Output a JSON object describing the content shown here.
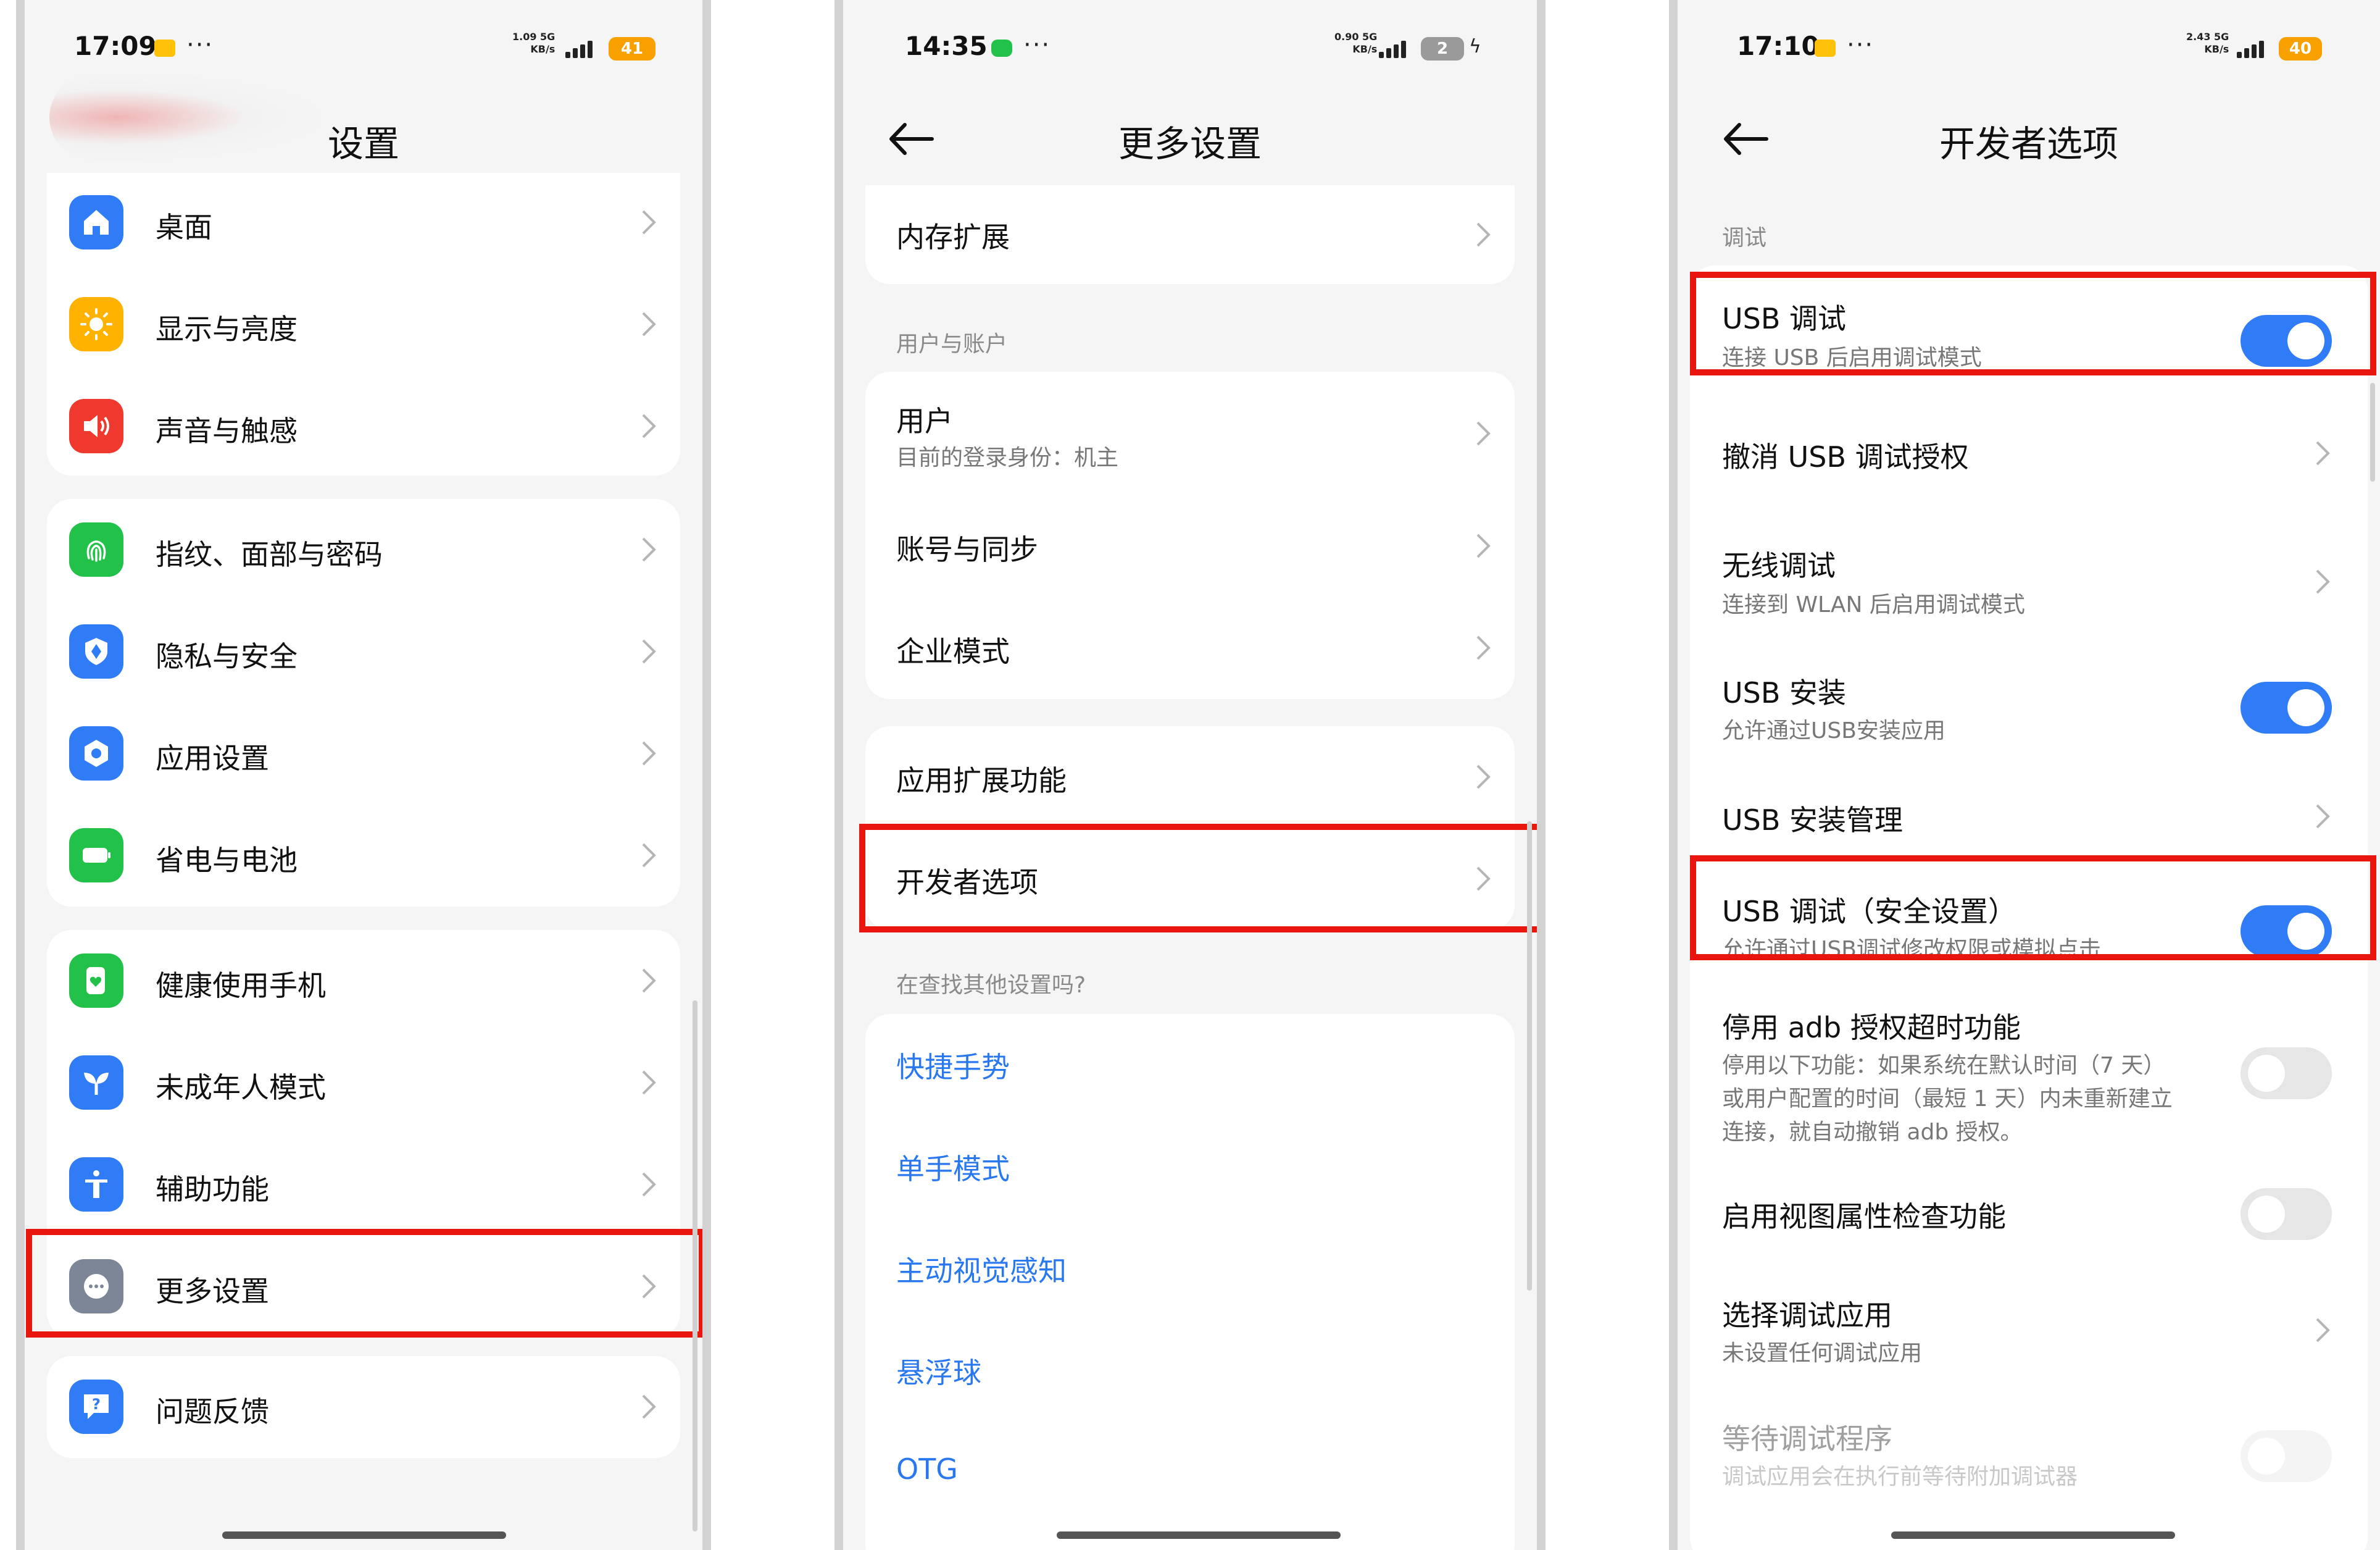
{
  "screen1": {
    "status": {
      "time": "17:09",
      "speed_top": "1.09 5G",
      "speed_bottom": "KB/s",
      "battery": "41"
    },
    "title": "设置",
    "items": [
      {
        "label": "桌面",
        "icon": "home-icon",
        "color": "#2f7cf6"
      },
      {
        "label": "显示与亮度",
        "icon": "sun-icon",
        "color": "#ffb300"
      },
      {
        "label": "声音与触感",
        "icon": "speaker-icon",
        "color": "#f0392e"
      },
      {
        "label": "指纹、面部与密码",
        "icon": "fingerprint-icon",
        "color": "#22c24a"
      },
      {
        "label": "隐私与安全",
        "icon": "shield-icon",
        "color": "#2f7cf6"
      },
      {
        "label": "应用设置",
        "icon": "app-gear-icon",
        "color": "#2f7cf6"
      },
      {
        "label": "省电与电池",
        "icon": "battery-icon",
        "color": "#22c24a"
      },
      {
        "label": "健康使用手机",
        "icon": "health-icon",
        "color": "#22c24a"
      },
      {
        "label": "未成年人模式",
        "icon": "sprout-icon",
        "color": "#2f7cf6"
      },
      {
        "label": "辅助功能",
        "icon": "accessibility-icon",
        "color": "#2f7cf6"
      },
      {
        "label": "更多设置",
        "icon": "more-dots-icon",
        "color": "#7d8696"
      },
      {
        "label": "问题反馈",
        "icon": "feedback-icon",
        "color": "#2f7cf6"
      }
    ]
  },
  "screen2": {
    "status": {
      "time": "14:35",
      "speed_top": "0.90 5G",
      "speed_bottom": "KB/s",
      "battery": "2"
    },
    "title": "更多设置",
    "memory": "内存扩展",
    "section_accounts": "用户与账户",
    "user_label": "用户",
    "user_sub": "目前的登录身份：机主",
    "account_sync": "账号与同步",
    "enterprise": "企业模式",
    "app_ext": "应用扩展功能",
    "developer": "开发者选项",
    "section_other": "在查找其他设置吗?",
    "links": [
      "快捷手势",
      "单手模式",
      "主动视觉感知",
      "悬浮球",
      "OTG"
    ]
  },
  "screen3": {
    "status": {
      "time": "17:10",
      "speed_top": "2.43 5G",
      "speed_bottom": "KB/s",
      "battery": "40"
    },
    "title": "开发者选项",
    "section_debug": "调试",
    "usb_debug": {
      "label": "USB 调试",
      "sub": "连接 USB 后启用调试模式",
      "on": true
    },
    "revoke": "撤消 USB 调试授权",
    "wireless": {
      "label": "无线调试",
      "sub": "连接到 WLAN 后启用调试模式"
    },
    "usb_install": {
      "label": "USB 安装",
      "sub": "允许通过USB安装应用",
      "on": true
    },
    "usb_install_mgmt": "USB 安装管理",
    "usb_debug_secure": {
      "label": "USB 调试（安全设置）",
      "sub": "允许通过USB调试修改权限或模拟点击",
      "on": true
    },
    "adb_timeout": {
      "label": "停用 adb 授权超时功能",
      "sub1": "停用以下功能：如果系统在默认时间（7 天）",
      "sub2": "或用户配置的时间（最短 1 天）内未重新建立",
      "sub3": "连接，就自动撤销 adb 授权。",
      "on": false
    },
    "view_attr": {
      "label": "启用视图属性检查功能",
      "on": false
    },
    "debug_app": {
      "label": "选择调试应用",
      "sub": "未设置任何调试应用"
    },
    "wait_debugger": {
      "label": "等待调试程序",
      "sub": "调试应用会在执行前等待附加调试器",
      "on": false
    }
  }
}
